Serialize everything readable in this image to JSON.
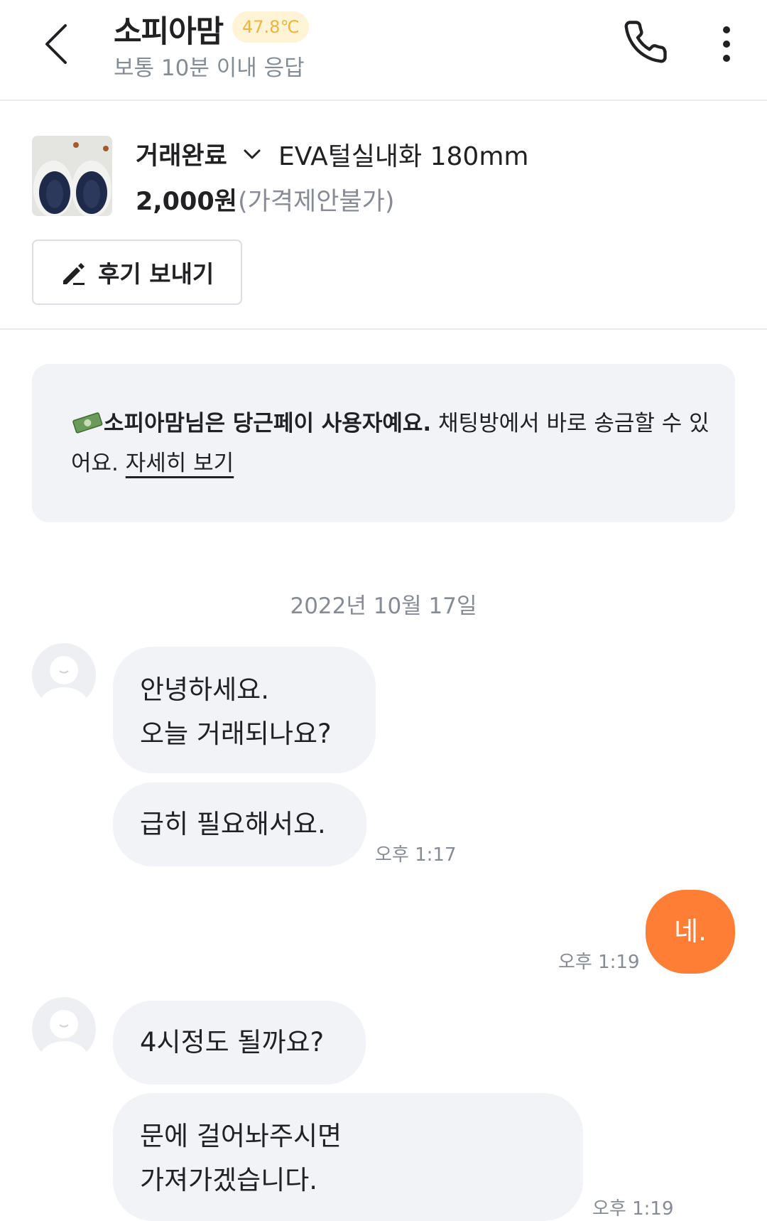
{
  "header": {
    "title": "소피아맘",
    "temperature": "47.8℃",
    "subtitle": "보통 10분 이내 응답",
    "back_icon": "chevron-left-icon",
    "phone_icon": "phone-icon",
    "more_icon": "more-vertical-icon"
  },
  "product": {
    "status": "거래완료",
    "title": "EVA털실내화 180mm",
    "price": "2,000원",
    "price_note": "(가격제안불가)",
    "review_button": "후기 보내기"
  },
  "notice": {
    "bold": "소피아맘님은 당근페이 사용자예요.",
    "text": " 채팅방에서 바로 송금할 수 있어요. ",
    "link": "자세히 보기"
  },
  "date_separator": "2022년 10월 17일",
  "messages": [
    {
      "sender": "other",
      "line1": "안녕하세요.",
      "line2": "오늘 거래되나요?"
    },
    {
      "sender": "other",
      "text": "급히 필요해서요.",
      "time": "오후 1:17"
    },
    {
      "sender": "me",
      "text": "네.",
      "time": "오후 1:19"
    },
    {
      "sender": "other",
      "text": "4시정도 될까요?"
    },
    {
      "sender": "other",
      "line1": "문에 걸어놔주시면",
      "line2": "가져가겠습니다.",
      "time": "오후 1:19"
    }
  ],
  "colors": {
    "accent": "#ff7e36",
    "bubble_bg": "#f2f3f6",
    "temperature_badge": "#f0b33c"
  }
}
